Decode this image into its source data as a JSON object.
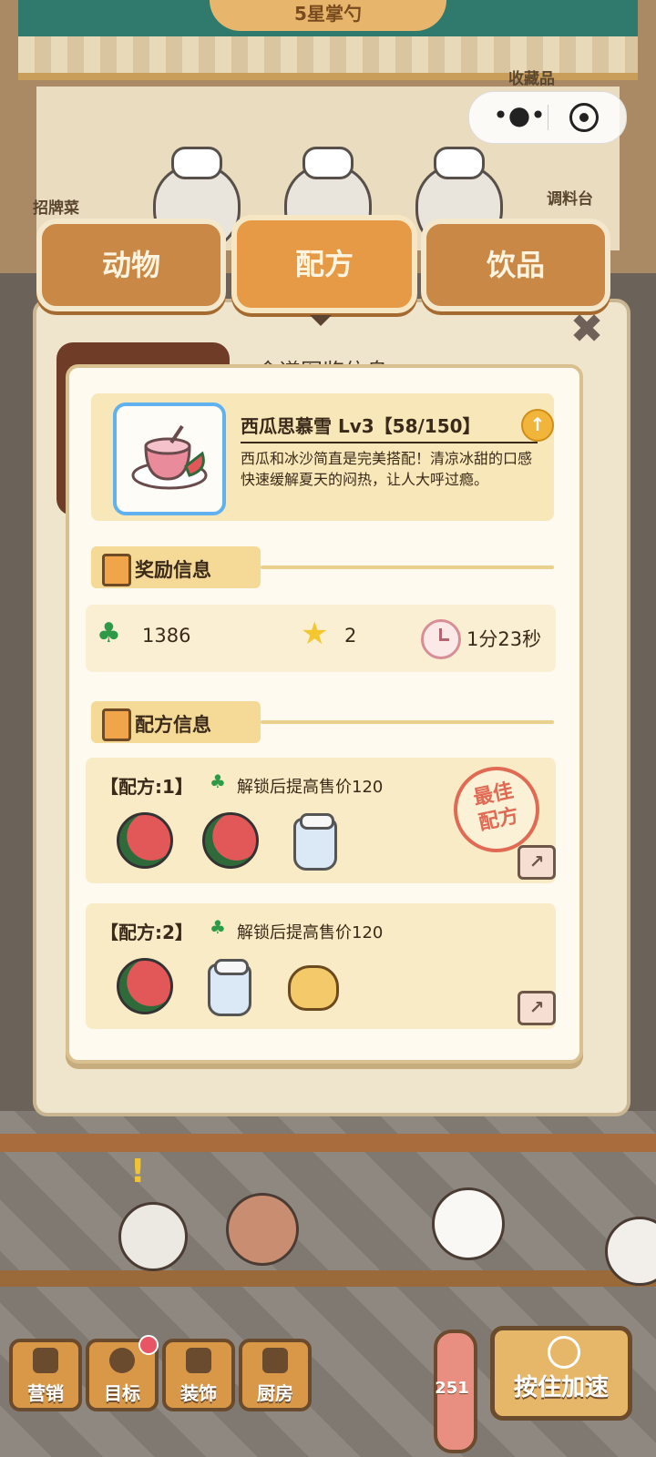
{
  "shop": {
    "sign": "5星掌勺",
    "right_label_top": "收藏品",
    "left_label": "招牌菜",
    "right_label": "调料台"
  },
  "tabs": [
    {
      "label": "动物",
      "active": false
    },
    {
      "label": "配方",
      "active": true
    },
    {
      "label": "饮品",
      "active": false
    }
  ],
  "background_title": "食谱图鉴信息",
  "dish": {
    "name": "西瓜思慕雪 Lv3【58/150】",
    "description": "西瓜和冰沙简直是完美搭配！清凉冰甜的口感快速缓解夏天的闷热，让人大呼过瘾。",
    "upgrade_icon": "up-arrow-icon"
  },
  "reward": {
    "title": "奖励信息",
    "clovers": "1386",
    "stars": "2",
    "time": "1分23秒"
  },
  "recipe": {
    "title": "配方信息",
    "items": [
      {
        "label": "【配方:1】",
        "note": "解锁后提高售价120",
        "ingredients": [
          "watermelon",
          "watermelon",
          "milk-jar"
        ],
        "stamp": "最佳配方",
        "stamp_line1": "最佳",
        "stamp_line2": "配方"
      },
      {
        "label": "【配方:2】",
        "note": "解锁后提高售价120",
        "ingredients": [
          "watermelon",
          "milk-jar",
          "honey-jar"
        ]
      }
    ]
  },
  "bottom_bar": {
    "buttons": [
      "营销",
      "目标",
      "装饰",
      "厨房"
    ],
    "target_notification": true,
    "temperature": "251",
    "speed_button": "按住加速"
  },
  "colors": {
    "tab": "#c98845",
    "tab_active": "#e69a45",
    "panel": "#efe5cc",
    "highlight": "#f8e7b8",
    "accent_blue": "#5fb2ef",
    "stamp_red": "#e06a53"
  }
}
